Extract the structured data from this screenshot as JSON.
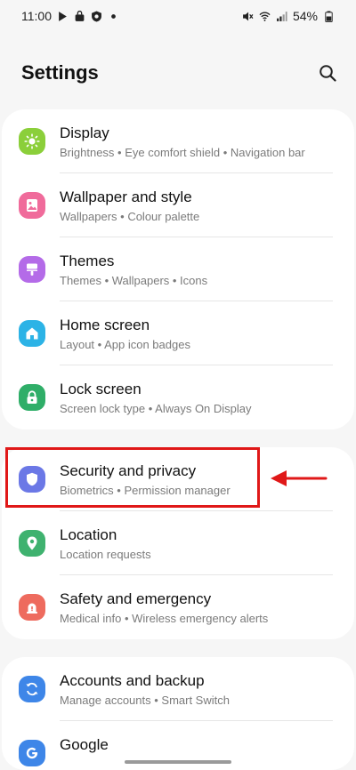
{
  "status_bar": {
    "time": "11:00",
    "battery": "54%"
  },
  "header": {
    "title": "Settings"
  },
  "colors": {
    "display": "#8bcf3a",
    "wallpaper": "#f06b9b",
    "themes": "#b46be8",
    "home_screen": "#2cb3e6",
    "lock_screen": "#2fae68",
    "security": "#6b78e6",
    "location": "#3fb26f",
    "safety": "#ee6b5e",
    "accounts": "#3e86e8",
    "google": "#3e86e8",
    "annotation": "#e01818"
  },
  "groups": [
    {
      "items": [
        {
          "title": "Display",
          "subtitle": "Brightness  •  Eye comfort shield  •  Navigation bar",
          "icon": "sun-icon"
        },
        {
          "title": "Wallpaper and style",
          "subtitle": "Wallpapers  •  Colour palette",
          "icon": "wallpaper-icon"
        },
        {
          "title": "Themes",
          "subtitle": "Themes  •  Wallpapers  •  Icons",
          "icon": "brush-icon"
        },
        {
          "title": "Home screen",
          "subtitle": "Layout  •  App icon badges",
          "icon": "home-icon"
        },
        {
          "title": "Lock screen",
          "subtitle": "Screen lock type  •  Always On Display",
          "icon": "lock-icon"
        }
      ]
    },
    {
      "items": [
        {
          "title": "Security and privacy",
          "subtitle": "Biometrics  •  Permission manager",
          "icon": "shield-icon"
        },
        {
          "title": "Location",
          "subtitle": "Location requests",
          "icon": "location-pin-icon"
        },
        {
          "title": "Safety and emergency",
          "subtitle": "Medical info  •  Wireless emergency alerts",
          "icon": "siren-icon"
        }
      ]
    },
    {
      "items": [
        {
          "title": "Accounts and backup",
          "subtitle": "Manage accounts  •  Smart Switch",
          "icon": "sync-icon"
        },
        {
          "title": "Google",
          "subtitle": "",
          "icon": "google-icon"
        }
      ]
    }
  ]
}
